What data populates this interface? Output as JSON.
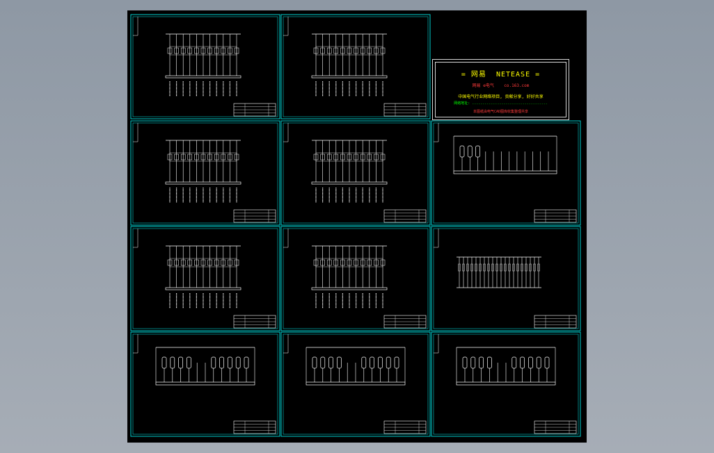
{
  "viewport": {
    "background": "#000000",
    "sheet_frame_color": "#00d0d0",
    "drawing_color": "#ffffff",
    "title_block_color": "#ffffff"
  },
  "banner": {
    "title": "= 网易  NETEASE =",
    "line2": "网易 e电气    co.163.com",
    "line3": "中国电气行业网络项目, 贡献分享, 好好共享",
    "line4": "网络地址: ....................................",
    "line5": "本图纸由电气CAD图库收集整理共享",
    "color_title": "#ffff00",
    "color_red": "#ff3b3b",
    "color_green": "#00ff00"
  },
  "sheets": [
    {
      "row": 0,
      "col": 0,
      "kind": "panel-a"
    },
    {
      "row": 0,
      "col": 1,
      "kind": "panel-b"
    },
    {
      "row": 1,
      "col": 0,
      "kind": "panel-a"
    },
    {
      "row": 1,
      "col": 1,
      "kind": "panel-b"
    },
    {
      "row": 1,
      "col": 2,
      "kind": "elev-sparse"
    },
    {
      "row": 2,
      "col": 0,
      "kind": "panel-a"
    },
    {
      "row": 2,
      "col": 1,
      "kind": "panel-b"
    },
    {
      "row": 2,
      "col": 2,
      "kind": "panel-c"
    },
    {
      "row": 3,
      "col": 0,
      "kind": "elev-full"
    },
    {
      "row": 3,
      "col": 1,
      "kind": "elev-full"
    },
    {
      "row": 3,
      "col": 2,
      "kind": "elev-full"
    }
  ]
}
